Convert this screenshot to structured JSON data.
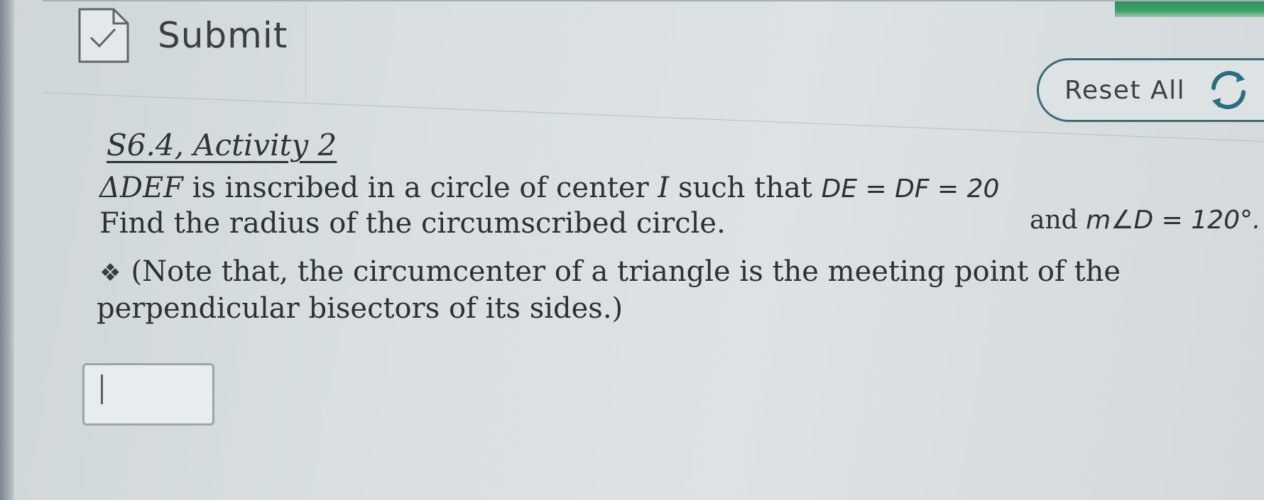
{
  "toolbar": {
    "submit_label": "Submit",
    "reset_label": "Reset All"
  },
  "activity": {
    "title": "S6.4, Activity 2",
    "line1_prefix": "ΔDEF",
    "line1_text": " is inscribed in a circle of center ",
    "line1_center": "I",
    "line1_suffix": " such that ",
    "line1_condition": "DE = DF = 20",
    "line2_text": "Find the radius of the circumscribed circle.",
    "line2_and": " and ",
    "line2_angle": "m∠D = 120°.",
    "note_line1": "(Note that, the circumcenter of a triangle is the meeting point of the",
    "note_line2": "perpendicular bisectors of its sides.)"
  },
  "answer": {
    "value": ""
  },
  "colors": {
    "reset_border": "#3d6b75",
    "refresh_icon": "#2b6f7d",
    "brand_green": "#3aa068"
  },
  "icons": {
    "submit": "document-check-icon",
    "reset": "refresh-icon",
    "note_bullet": "diamond-bullet-icon"
  }
}
